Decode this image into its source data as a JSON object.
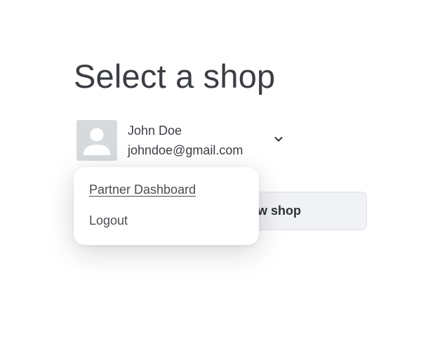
{
  "page": {
    "title": "Select a shop"
  },
  "account": {
    "name": "John Doe",
    "email": "johndoe@gmail.com",
    "avatar_icon": "user-silhouette-icon",
    "chevron_icon": "chevron-down-icon"
  },
  "actions": {
    "add_shop_label": "Add a new shop"
  },
  "menu": {
    "items": [
      {
        "label": "Partner Dashboard"
      },
      {
        "label": "Logout"
      }
    ]
  },
  "colors": {
    "text": "#3b3f45",
    "avatar_bg": "#d7dadd",
    "avatar_fg": "#ffffff",
    "button_bg": "#f1f2f6",
    "button_border": "#dfe1e7",
    "menu_bg": "#ffffff"
  }
}
